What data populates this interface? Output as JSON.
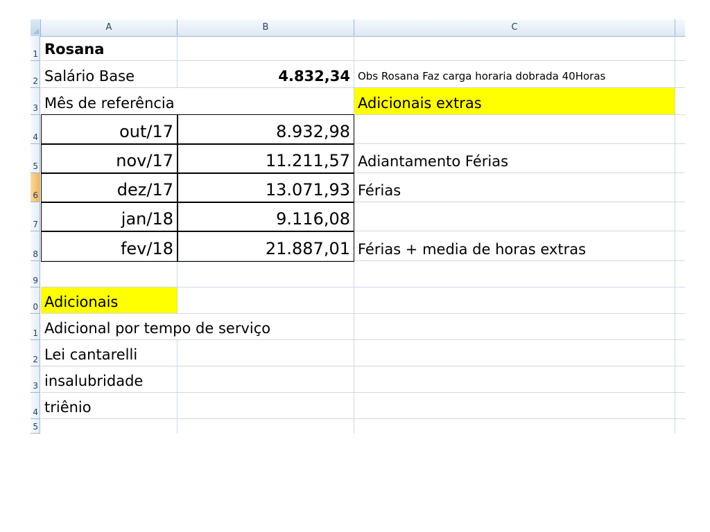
{
  "columns": [
    "A",
    "B",
    "C"
  ],
  "row_numbers": [
    "1",
    "2",
    "3",
    "4",
    "5",
    "6",
    "7",
    "8",
    "9",
    "0",
    "1",
    "2",
    "3",
    "4",
    "5"
  ],
  "header": {
    "name": "Rosana",
    "salario_label": "Salário Base",
    "salario_value": "4.832,34",
    "obs": "Obs Rosana Faz carga horaria dobrada 40Horas",
    "mes_label": "Mês de referência",
    "adicionais_extras": "Adicionais extras"
  },
  "months": [
    {
      "month": "out/17",
      "value": "8.932,98",
      "note": ""
    },
    {
      "month": "nov/17",
      "value": "11.211,57",
      "note": "Adiantamento Férias"
    },
    {
      "month": "dez/17",
      "value": "13.071,93",
      "note": "Férias"
    },
    {
      "month": "jan/18",
      "value": "9.116,08",
      "note": ""
    },
    {
      "month": "fev/18",
      "value": "21.887,01",
      "note": "Férias + media de horas extras"
    }
  ],
  "adicionais": {
    "title": "Adicionais",
    "items": [
      "Adicional por tempo de serviço",
      "Lei cantarelli",
      "insalubridade",
      "triênio"
    ]
  },
  "colors": {
    "highlight": "#ffff00",
    "header_bg": "#dde8f5",
    "selected_row": "#f1b458"
  }
}
